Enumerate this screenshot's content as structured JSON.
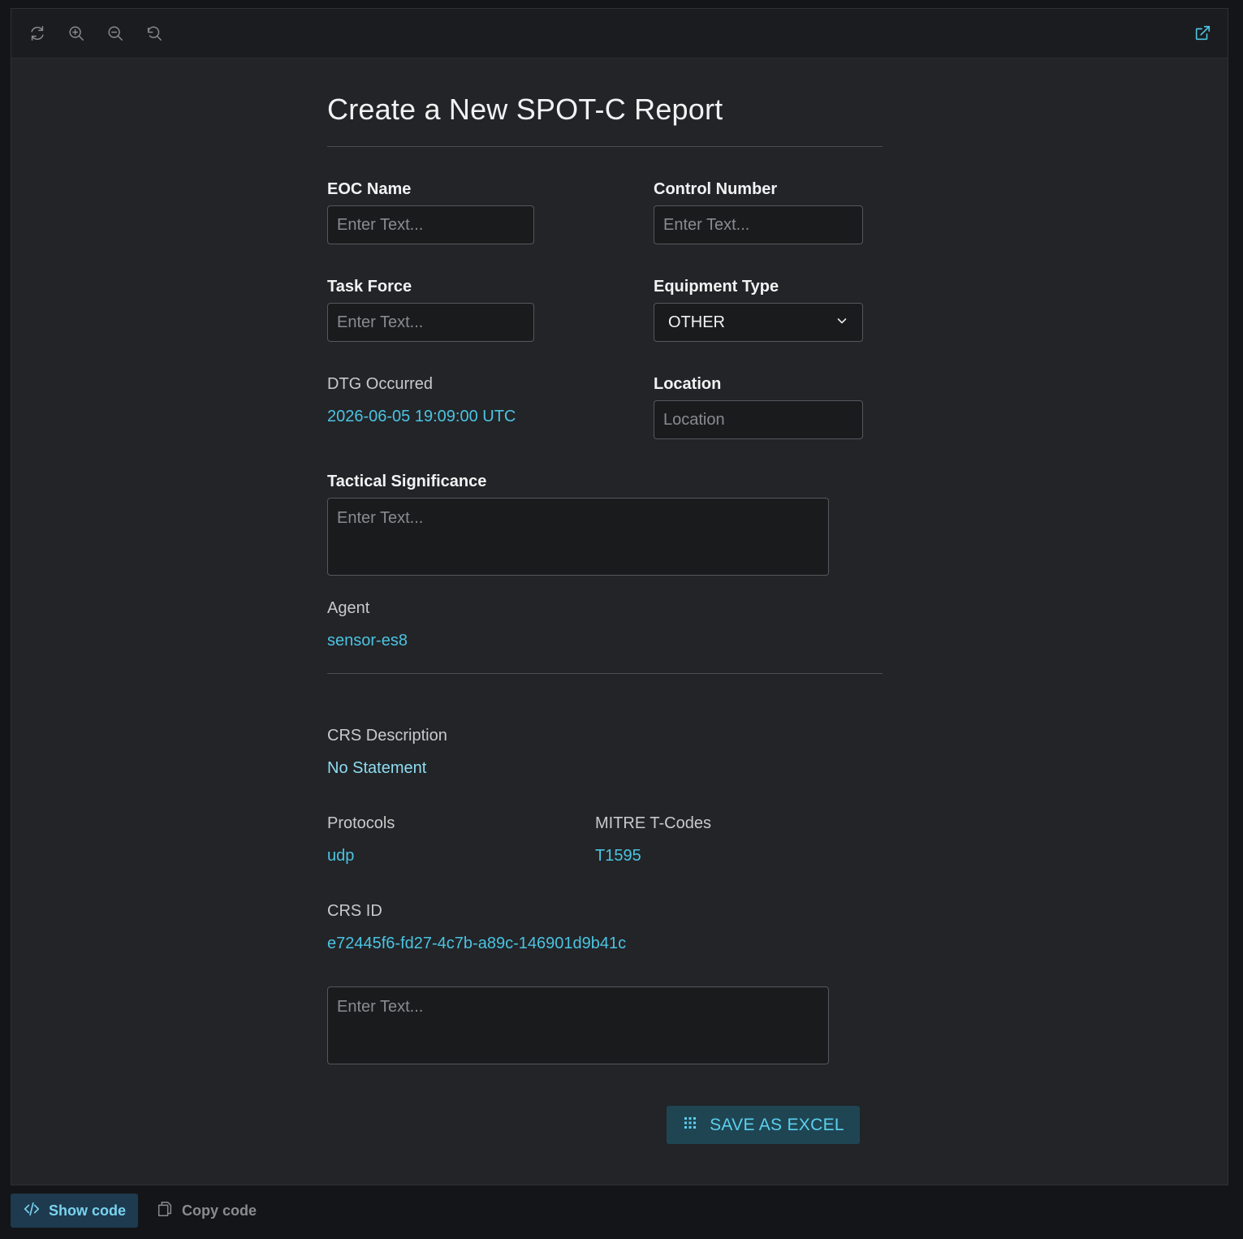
{
  "toolbar": {
    "icons": [
      "refresh-icon",
      "zoom-in-icon",
      "zoom-out-icon",
      "reset-zoom-icon",
      "open-external-icon"
    ]
  },
  "form": {
    "title": "Create a New SPOT-C Report",
    "eoc_name": {
      "label": "EOC Name",
      "placeholder": "Enter Text...",
      "value": ""
    },
    "control_number": {
      "label": "Control Number",
      "placeholder": "Enter Text...",
      "value": ""
    },
    "task_force": {
      "label": "Task Force",
      "placeholder": "Enter Text...",
      "value": ""
    },
    "equipment_type": {
      "label": "Equipment Type",
      "selected": "OTHER"
    },
    "dtg_occurred": {
      "label": "DTG Occurred",
      "value": "2026-06-05 19:09:00 UTC"
    },
    "location": {
      "label": "Location",
      "placeholder": "Location",
      "value": ""
    },
    "tactical_significance": {
      "label": "Tactical Significance",
      "placeholder": "Enter Text...",
      "value": ""
    },
    "agent": {
      "label": "Agent",
      "value": "sensor-es8"
    },
    "crs_description": {
      "label": "CRS Description",
      "value": "No Statement"
    },
    "protocols": {
      "label": "Protocols",
      "value": "udp"
    },
    "mitre_tcodes": {
      "label": "MITRE T-Codes",
      "value": "T1595"
    },
    "crs_id": {
      "label": "CRS ID",
      "value": "e72445f6-fd27-4c7b-a89c-146901d9b41c"
    },
    "notes": {
      "placeholder": "Enter Text...",
      "value": ""
    },
    "save_button": "SAVE AS EXCEL"
  },
  "footer": {
    "show_code": "Show code",
    "copy_code": "Copy code"
  },
  "colors": {
    "accent": "#4cc3e0",
    "background": "#222428",
    "button_bg": "#1f4553"
  }
}
